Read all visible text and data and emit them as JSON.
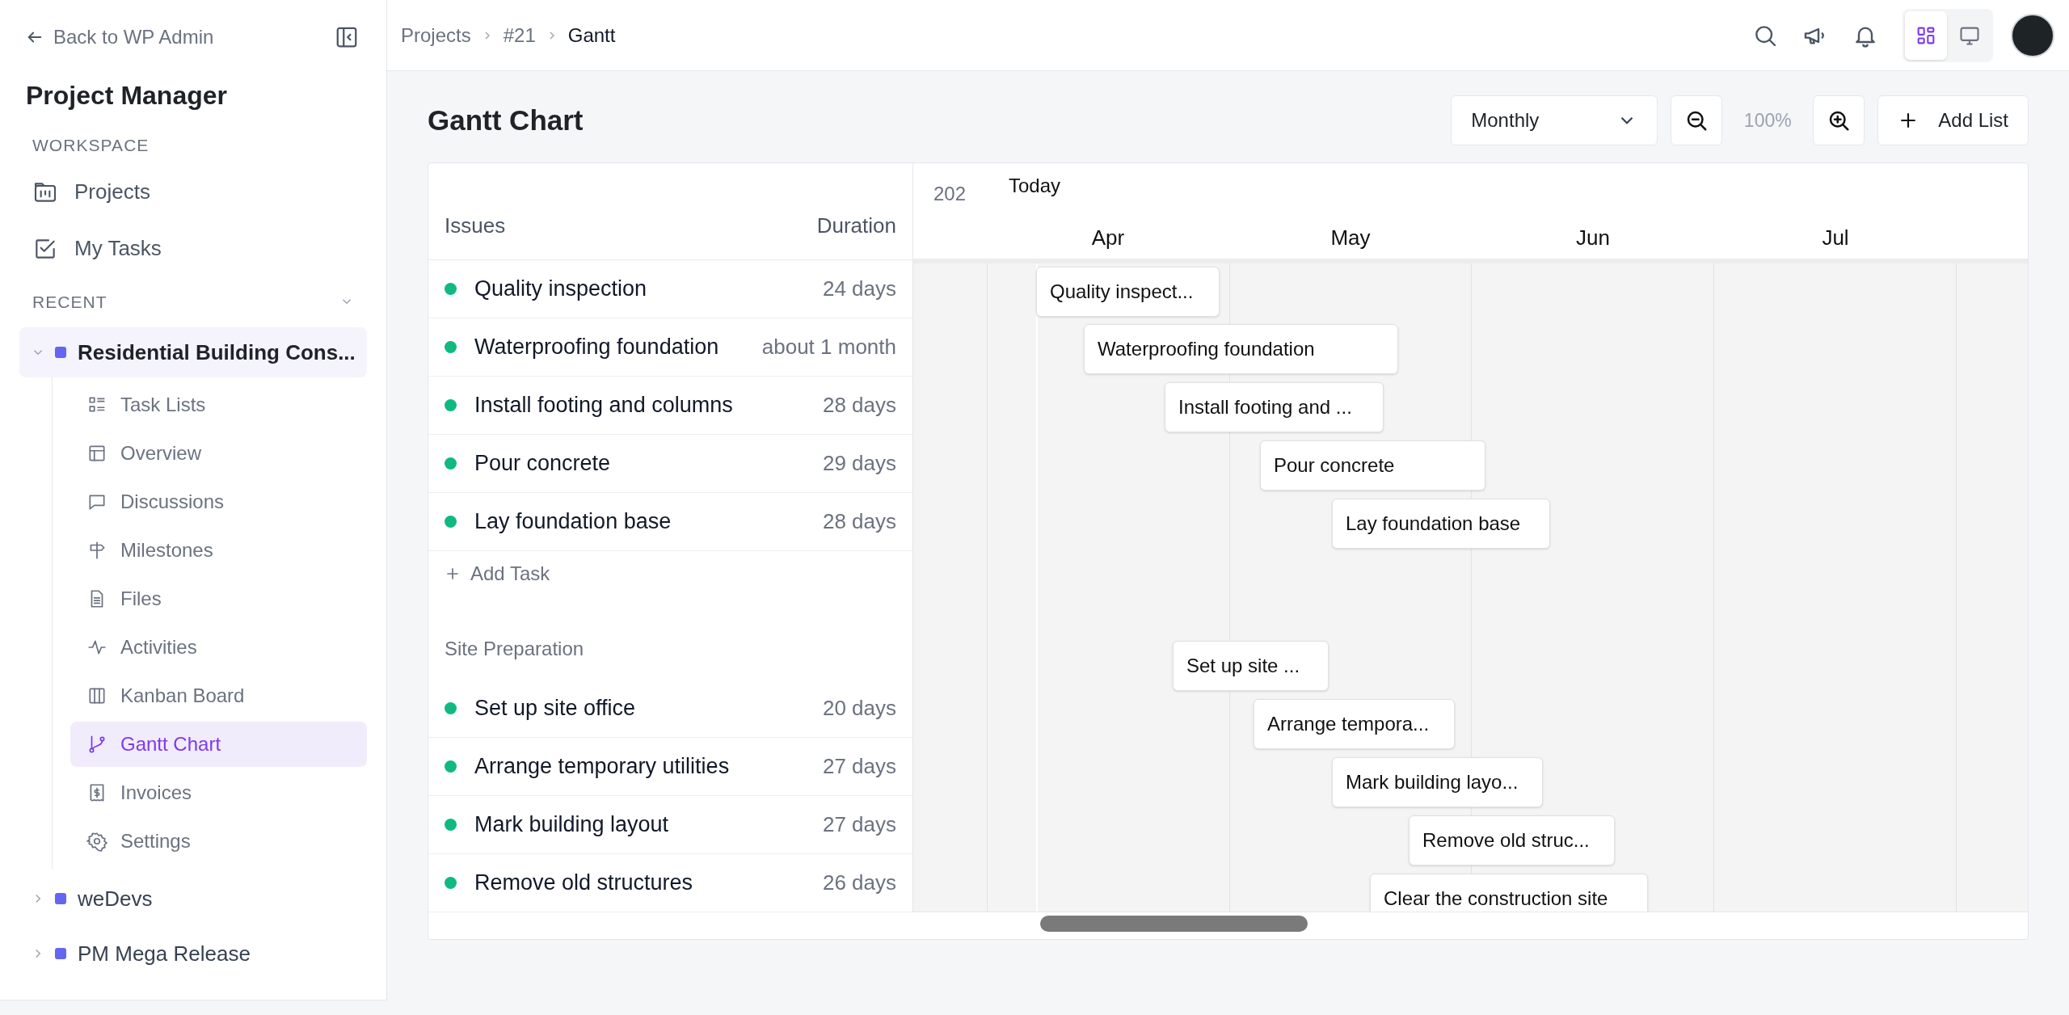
{
  "sidebar": {
    "back_link": "Back to WP Admin",
    "title": "Project Manager",
    "workspace": {
      "label": "WORKSPACE",
      "items": [
        {
          "kind": "projects",
          "label": "Projects"
        },
        {
          "kind": "tasks",
          "label": "My Tasks"
        }
      ]
    },
    "recent": {
      "label": "RECENT",
      "projects": [
        {
          "name": "Residential Building Cons...",
          "expanded": true,
          "children": [
            {
              "kind": "lists",
              "label": "Task Lists",
              "selected": false
            },
            {
              "kind": "overview",
              "label": "Overview",
              "selected": false
            },
            {
              "kind": "discussions",
              "label": "Discussions",
              "selected": false
            },
            {
              "kind": "milestones",
              "label": "Milestones",
              "selected": false
            },
            {
              "kind": "files",
              "label": "Files",
              "selected": false
            },
            {
              "kind": "activities",
              "label": "Activities",
              "selected": false
            },
            {
              "kind": "kanban",
              "label": "Kanban Board",
              "selected": false
            },
            {
              "kind": "gantt",
              "label": "Gantt Chart",
              "selected": true
            },
            {
              "kind": "invoices",
              "label": "Invoices",
              "selected": false
            },
            {
              "kind": "settings",
              "label": "Settings",
              "selected": false
            }
          ]
        },
        {
          "name": "weDevs",
          "expanded": false
        },
        {
          "name": "PM Mega Release",
          "expanded": false
        }
      ]
    }
  },
  "breadcrumbs": [
    {
      "label": "Projects",
      "current": false
    },
    {
      "label": "#21",
      "current": false
    },
    {
      "label": "Gantt",
      "current": true
    }
  ],
  "view_toggle": [
    {
      "kind": "grid",
      "selected": true
    },
    {
      "kind": "monitor",
      "selected": false
    }
  ],
  "header": {
    "title": "Gantt Chart",
    "view_select": "Monthly",
    "zoom": "100%",
    "add_list": "Add List"
  },
  "gantt": {
    "columns": [
      "Issues",
      "Duration"
    ],
    "groups": [
      {
        "tasks": [
          {
            "name": "Quality inspection",
            "duration": "24 days",
            "bar_label": "Quality inspect..."
          },
          {
            "name": "Waterproofing foundation",
            "duration": "about 1 month",
            "bar_label": "Waterproofing foundation"
          },
          {
            "name": "Install footing and columns",
            "duration": "28 days",
            "bar_label": "Install footing and ..."
          },
          {
            "name": "Pour concrete",
            "duration": "29 days",
            "bar_label": "Pour concrete"
          },
          {
            "name": "Lay foundation base",
            "duration": "28 days",
            "bar_label": "Lay foundation base"
          }
        ],
        "add_task": "Add Task"
      },
      {
        "title": "Site Preparation",
        "tasks": [
          {
            "name": "Set up site office",
            "duration": "20 days",
            "bar_label": "Set up site ..."
          },
          {
            "name": "Arrange temporary utilities",
            "duration": "27 days",
            "bar_label": "Arrange tempora..."
          },
          {
            "name": "Mark building layout",
            "duration": "27 days",
            "bar_label": "Mark building layo..."
          },
          {
            "name": "Remove old structures",
            "duration": "26 days",
            "bar_label": "Remove old struc..."
          }
        ]
      }
    ],
    "extra_bars": [
      {
        "bar_label": "Clear the construction site"
      }
    ],
    "timeline": {
      "year": "202",
      "today": "Today",
      "months": [
        "Apr",
        "May",
        "Jun",
        "Jul"
      ]
    }
  }
}
